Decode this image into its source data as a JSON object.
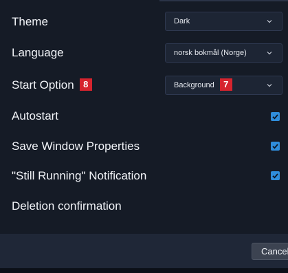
{
  "settings": {
    "theme": {
      "label": "Theme",
      "value": "Dark"
    },
    "language": {
      "label": "Language",
      "value": "norsk bokmål (Norge)"
    },
    "start_option": {
      "label": "Start Option",
      "label_badge": "8",
      "value": "Background",
      "value_badge": "7"
    },
    "autostart": {
      "label": "Autostart",
      "checked": true
    },
    "save_window_properties": {
      "label": "Save Window Properties",
      "checked": true
    },
    "still_running_notification": {
      "label": "\"Still Running\" Notification",
      "checked": true
    },
    "deletion_confirmation": {
      "label": "Deletion confirmation"
    }
  },
  "footer": {
    "cancel_label": "Cancel"
  },
  "colors": {
    "background": "#151b26",
    "footer": "#1f2737",
    "accent_checkbox": "#2f8ddb",
    "badge": "#d6242e"
  },
  "icons": {
    "dropdown": "chevron-down-icon",
    "checked": "checkmark-icon"
  }
}
